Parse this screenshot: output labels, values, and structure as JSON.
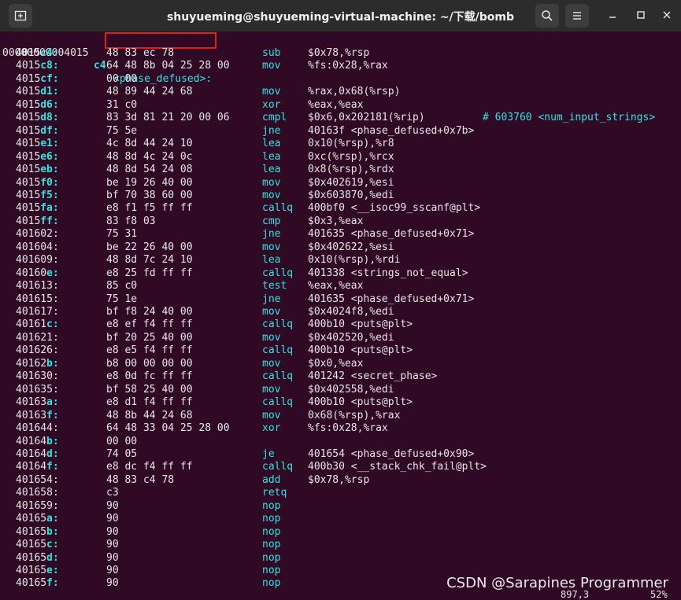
{
  "window": {
    "title": "shuyueming@shuyueming-virtual-machine: ~/下载/bomb",
    "new_tab_icon": "new-tab-icon",
    "search_icon": "search-icon",
    "menu_icon": "hamburger-menu-icon",
    "minimize_icon": "minimize-icon",
    "maximize_icon": "maximize-icon",
    "close_icon": "close-icon"
  },
  "header": {
    "address_plain": "00000000004015",
    "address_blue": "c4",
    "label": "<phase_defused>:"
  },
  "colors": {
    "background": "#300a24",
    "titlebar": "#2c2c2c",
    "cyan": "#34e2e2",
    "text": "#e6e6e6",
    "highlight_box": "#e02020"
  },
  "lines": [
    {
      "addr_a": "4015",
      "addr_b": "c4:",
      "bytes": "48 83 ec 78",
      "mnem": "sub",
      "ops": "$0x78,%rsp",
      "cmt": ""
    },
    {
      "addr_a": "4015",
      "addr_b": "c8:",
      "bytes": "64 48 8b 04 25 28 00",
      "mnem": "mov",
      "ops": "%fs:0x28,%rax",
      "cmt": ""
    },
    {
      "addr_a": "4015",
      "addr_b": "cf:",
      "bytes": "00 00",
      "mnem": "",
      "ops": "",
      "cmt": ""
    },
    {
      "addr_a": "4015",
      "addr_b": "d1:",
      "bytes": "48 89 44 24 68",
      "mnem": "mov",
      "ops": "%rax,0x68(%rsp)",
      "cmt": ""
    },
    {
      "addr_a": "4015",
      "addr_b": "d6:",
      "bytes": "31 c0",
      "mnem": "xor",
      "ops": "%eax,%eax",
      "cmt": ""
    },
    {
      "addr_a": "4015",
      "addr_b": "d8:",
      "bytes": "83 3d 81 21 20 00 06",
      "mnem": "cmpl",
      "ops": "$0x6,0x202181(%rip)",
      "cmt": "# 603760 <num_input_strings>"
    },
    {
      "addr_a": "4015",
      "addr_b": "df:",
      "bytes": "75 5e",
      "mnem": "jne",
      "ops": "40163f <phase_defused+0x7b>",
      "cmt": ""
    },
    {
      "addr_a": "4015",
      "addr_b": "e1:",
      "bytes": "4c 8d 44 24 10",
      "mnem": "lea",
      "ops": "0x10(%rsp),%r8",
      "cmt": ""
    },
    {
      "addr_a": "4015",
      "addr_b": "e6:",
      "bytes": "48 8d 4c 24 0c",
      "mnem": "lea",
      "ops": "0xc(%rsp),%rcx",
      "cmt": ""
    },
    {
      "addr_a": "4015",
      "addr_b": "eb:",
      "bytes": "48 8d 54 24 08",
      "mnem": "lea",
      "ops": "0x8(%rsp),%rdx",
      "cmt": ""
    },
    {
      "addr_a": "4015",
      "addr_b": "f0:",
      "bytes": "be 19 26 40 00",
      "mnem": "mov",
      "ops": "$0x402619,%esi",
      "cmt": ""
    },
    {
      "addr_a": "4015",
      "addr_b": "f5:",
      "bytes": "bf 70 38 60 00",
      "mnem": "mov",
      "ops": "$0x603870,%edi",
      "cmt": ""
    },
    {
      "addr_a": "4015",
      "addr_b": "fa:",
      "bytes": "e8 f1 f5 ff ff",
      "mnem": "callq",
      "ops": "400bf0 <__isoc99_sscanf@plt>",
      "cmt": ""
    },
    {
      "addr_a": "4015",
      "addr_b": "ff:",
      "bytes": "83 f8 03",
      "mnem": "cmp",
      "ops": "$0x3,%eax",
      "cmt": ""
    },
    {
      "addr_a": "401602:",
      "addr_b": "",
      "bytes": "75 31",
      "mnem": "jne",
      "ops": "401635 <phase_defused+0x71>",
      "cmt": ""
    },
    {
      "addr_a": "401604:",
      "addr_b": "",
      "bytes": "be 22 26 40 00",
      "mnem": "mov",
      "ops": "$0x402622,%esi",
      "cmt": ""
    },
    {
      "addr_a": "401609:",
      "addr_b": "",
      "bytes": "48 8d 7c 24 10",
      "mnem": "lea",
      "ops": "0x10(%rsp),%rdi",
      "cmt": ""
    },
    {
      "addr_a": "40160",
      "addr_b": "e:",
      "bytes": "e8 25 fd ff ff",
      "mnem": "callq",
      "ops": "401338 <strings_not_equal>",
      "cmt": ""
    },
    {
      "addr_a": "401613:",
      "addr_b": "",
      "bytes": "85 c0",
      "mnem": "test",
      "ops": "%eax,%eax",
      "cmt": ""
    },
    {
      "addr_a": "401615:",
      "addr_b": "",
      "bytes": "75 1e",
      "mnem": "jne",
      "ops": "401635 <phase_defused+0x71>",
      "cmt": ""
    },
    {
      "addr_a": "401617:",
      "addr_b": "",
      "bytes": "bf f8 24 40 00",
      "mnem": "mov",
      "ops": "$0x4024f8,%edi",
      "cmt": ""
    },
    {
      "addr_a": "40161",
      "addr_b": "c:",
      "bytes": "e8 ef f4 ff ff",
      "mnem": "callq",
      "ops": "400b10 <puts@plt>",
      "cmt": ""
    },
    {
      "addr_a": "401621:",
      "addr_b": "",
      "bytes": "bf 20 25 40 00",
      "mnem": "mov",
      "ops": "$0x402520,%edi",
      "cmt": ""
    },
    {
      "addr_a": "401626:",
      "addr_b": "",
      "bytes": "e8 e5 f4 ff ff",
      "mnem": "callq",
      "ops": "400b10 <puts@plt>",
      "cmt": ""
    },
    {
      "addr_a": "40162",
      "addr_b": "b:",
      "bytes": "b8 00 00 00 00",
      "mnem": "mov",
      "ops": "$0x0,%eax",
      "cmt": ""
    },
    {
      "addr_a": "401630:",
      "addr_b": "",
      "bytes": "e8 0d fc ff ff",
      "mnem": "callq",
      "ops": "401242 <secret_phase>",
      "cmt": ""
    },
    {
      "addr_a": "401635:",
      "addr_b": "",
      "bytes": "bf 58 25 40 00",
      "mnem": "mov",
      "ops": "$0x402558,%edi",
      "cmt": ""
    },
    {
      "addr_a": "40163",
      "addr_b": "a:",
      "bytes": "e8 d1 f4 ff ff",
      "mnem": "callq",
      "ops": "400b10 <puts@plt>",
      "cmt": ""
    },
    {
      "addr_a": "40163",
      "addr_b": "f:",
      "bytes": "48 8b 44 24 68",
      "mnem": "mov",
      "ops": "0x68(%rsp),%rax",
      "cmt": ""
    },
    {
      "addr_a": "401644:",
      "addr_b": "",
      "bytes": "64 48 33 04 25 28 00",
      "mnem": "xor",
      "ops": "%fs:0x28,%rax",
      "cmt": ""
    },
    {
      "addr_a": "40164",
      "addr_b": "b:",
      "bytes": "00 00",
      "mnem": "",
      "ops": "",
      "cmt": ""
    },
    {
      "addr_a": "40164",
      "addr_b": "d:",
      "bytes": "74 05",
      "mnem": "je",
      "ops": "401654 <phase_defused+0x90>",
      "cmt": ""
    },
    {
      "addr_a": "40164",
      "addr_b": "f:",
      "bytes": "e8 dc f4 ff ff",
      "mnem": "callq",
      "ops": "400b30 <__stack_chk_fail@plt>",
      "cmt": ""
    },
    {
      "addr_a": "401654:",
      "addr_b": "",
      "bytes": "48 83 c4 78",
      "mnem": "add",
      "ops": "$0x78,%rsp",
      "cmt": ""
    },
    {
      "addr_a": "401658:",
      "addr_b": "",
      "bytes": "c3",
      "mnem": "retq",
      "ops": "",
      "cmt": ""
    },
    {
      "addr_a": "401659:",
      "addr_b": "",
      "bytes": "90",
      "mnem": "nop",
      "ops": "",
      "cmt": ""
    },
    {
      "addr_a": "40165",
      "addr_b": "a:",
      "bytes": "90",
      "mnem": "nop",
      "ops": "",
      "cmt": ""
    },
    {
      "addr_a": "40165",
      "addr_b": "b:",
      "bytes": "90",
      "mnem": "nop",
      "ops": "",
      "cmt": ""
    },
    {
      "addr_a": "40165",
      "addr_b": "c:",
      "bytes": "90",
      "mnem": "nop",
      "ops": "",
      "cmt": ""
    },
    {
      "addr_a": "40165",
      "addr_b": "d:",
      "bytes": "90",
      "mnem": "nop",
      "ops": "",
      "cmt": ""
    },
    {
      "addr_a": "40165",
      "addr_b": "e:",
      "bytes": "90",
      "mnem": "nop",
      "ops": "",
      "cmt": ""
    },
    {
      "addr_a": "40165",
      "addr_b": "f:",
      "bytes": "90",
      "mnem": "nop",
      "ops": "",
      "cmt": ""
    }
  ],
  "status": {
    "position": "897,3",
    "percent": "52%"
  },
  "watermark": "CSDN @Sarapines Programmer"
}
